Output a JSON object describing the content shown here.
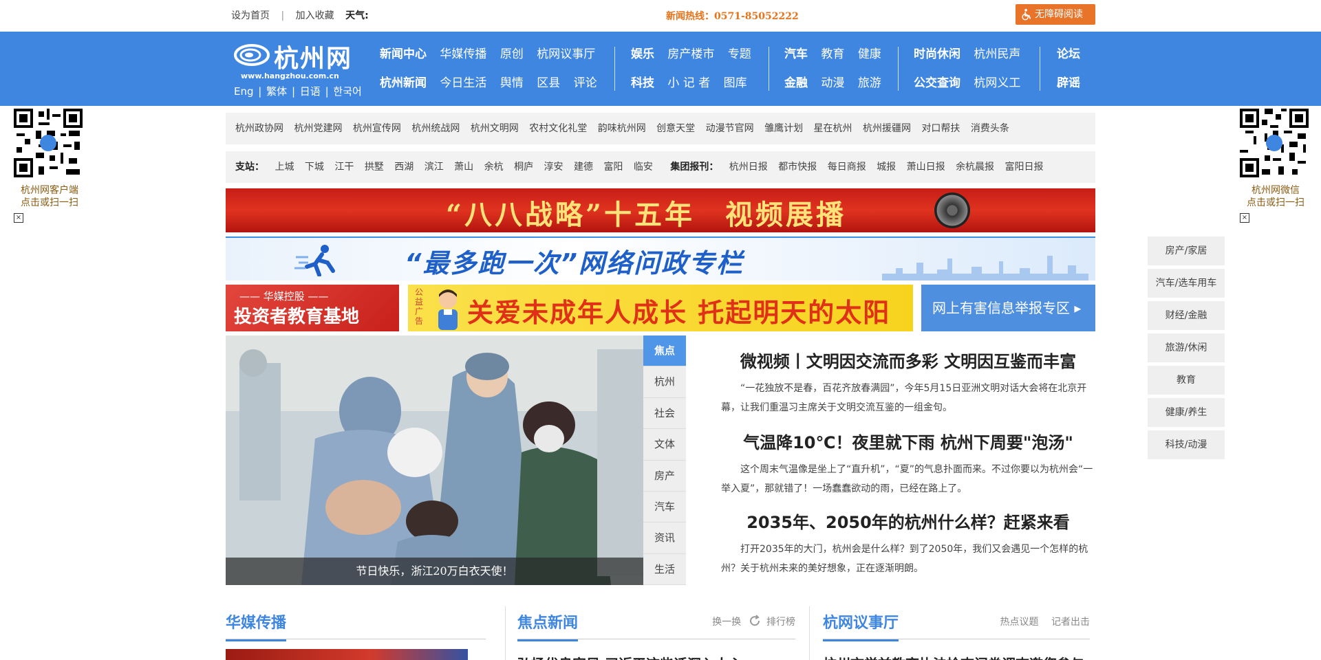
{
  "topbar": {
    "set_home": "设为首页",
    "separator": "|",
    "add_fav": "加入收藏",
    "weather": "天气:",
    "hotline": "新闻热线：0571-85052222",
    "accessibility": "无障碍阅读"
  },
  "logo": {
    "name": "杭州网",
    "url": "www.hangzhou.com.cn",
    "langs": [
      "Eng",
      "|",
      "繁体",
      "|",
      "日语",
      "|",
      "한국어"
    ]
  },
  "nav": {
    "groups": [
      {
        "rows": [
          [
            "新闻中心",
            "华媒传播",
            "原创",
            "杭网议事厅"
          ],
          [
            "杭州新闻",
            "今日生活",
            "舆情",
            "区县",
            "评论"
          ]
        ]
      },
      {
        "rows": [
          [
            "娱乐",
            "房产楼市",
            "专题"
          ],
          [
            "科技",
            "小 记 者",
            "图库"
          ]
        ]
      },
      {
        "rows": [
          [
            "汽车",
            "教育",
            "健康"
          ],
          [
            "金融",
            "动漫",
            "旅游"
          ]
        ]
      },
      {
        "rows": [
          [
            "时尚休闲",
            "杭州民声"
          ],
          [
            "公交查询",
            "杭网义工"
          ]
        ]
      },
      {
        "rows": [
          [
            "论坛"
          ],
          [
            "辟谣"
          ]
        ]
      }
    ]
  },
  "qr_left": {
    "caption1": "杭州网客户端",
    "caption2": "点击或扫一扫",
    "close": "×"
  },
  "qr_right": {
    "caption1": "杭州网微信",
    "caption2": "点击或扫一扫",
    "close": "×"
  },
  "linkbar1": [
    "杭州政协网",
    "杭州党建网",
    "杭州宣传网",
    "杭州统战网",
    "杭州文明网",
    "农村文化礼堂",
    "韵味杭州网",
    "创意天堂",
    "动漫节官网",
    "雏鹰计划",
    "星在杭州",
    "杭州援疆网",
    "对口帮扶",
    "消费头条"
  ],
  "linkbar2": {
    "label1": "支站：",
    "sites": [
      "上城",
      "下城",
      "江干",
      "拱墅",
      "西湖",
      "滨江",
      "萧山",
      "余杭",
      "桐庐",
      "淳安",
      "建德",
      "富阳",
      "临安"
    ],
    "label2": "集团报刊：",
    "papers": [
      "杭州日报",
      "都市快报",
      "每日商报",
      "城报",
      "萧山日报",
      "余杭晨报",
      "富阳日报"
    ]
  },
  "banners": {
    "b1": "“八八战略”十五年　视频展播",
    "b2": "“最多跑一次”网络问政专栏",
    "b3_t1": "—— 华媒控股 ——",
    "b3_t2": "投资者教育基地",
    "b4_tag": "公益广告",
    "b4": "关爱未成年人成长 托起明天的太阳",
    "b5": "网上有害信息举报专区 ▸"
  },
  "focus": {
    "caption": "节日快乐，浙江20万白衣天使！",
    "tabs": [
      "焦点",
      "杭州",
      "社会",
      "文体",
      "房产",
      "汽车",
      "资讯",
      "生活"
    ]
  },
  "headlines": [
    {
      "title": "微视频丨文明因交流而多彩 文明因互鉴而丰富",
      "summary": "“一花独放不是春，百花齐放春满园”，今年5月15日亚洲文明对话大会将在北京开幕，让我们重温习主席关于文明交流互鉴的一组金句。"
    },
    {
      "title": "气温降10℃！夜里就下雨 杭州下周要\"泡汤\"",
      "summary": "这个周末气温像是坐上了“直升机”，“夏”的气息扑面而来。不过你要以为杭州会“一举入夏”，那就错了！一场蠢蠢欲动的雨，已经在路上了。"
    },
    {
      "title": "2035年、2050年的杭州什么样？赶紧来看",
      "summary": "打开2035年的大门，杭州会是什么样？到了2050年，我们又会遇见一个怎样的杭州？关于杭州未来的美好想象，正在逐渐明朗。"
    }
  ],
  "sidemenu": [
    "房产/家居",
    "汽车/选车用车",
    "财经/金融",
    "旅游/休闲",
    "教育",
    "健康/养生",
    "科技/动漫"
  ],
  "sections": {
    "huamei": {
      "title": "华媒传播"
    },
    "jiaodian": {
      "title": "焦点新闻",
      "extra1": "换一换",
      "extra2": "排行榜",
      "item": "弘扬优良家风 习近平这些话深入人心"
    },
    "yishiting": {
      "title": "杭网议事厅",
      "extra1": "热点议题",
      "extra2": "记者出击",
      "item": "杭州市学前教育执法检查问卷调查邀您参与"
    }
  },
  "colors": {
    "nav_blue": "#3f86e0",
    "hotline_orange": "#e6731a",
    "access_orange": "#e8742a"
  }
}
